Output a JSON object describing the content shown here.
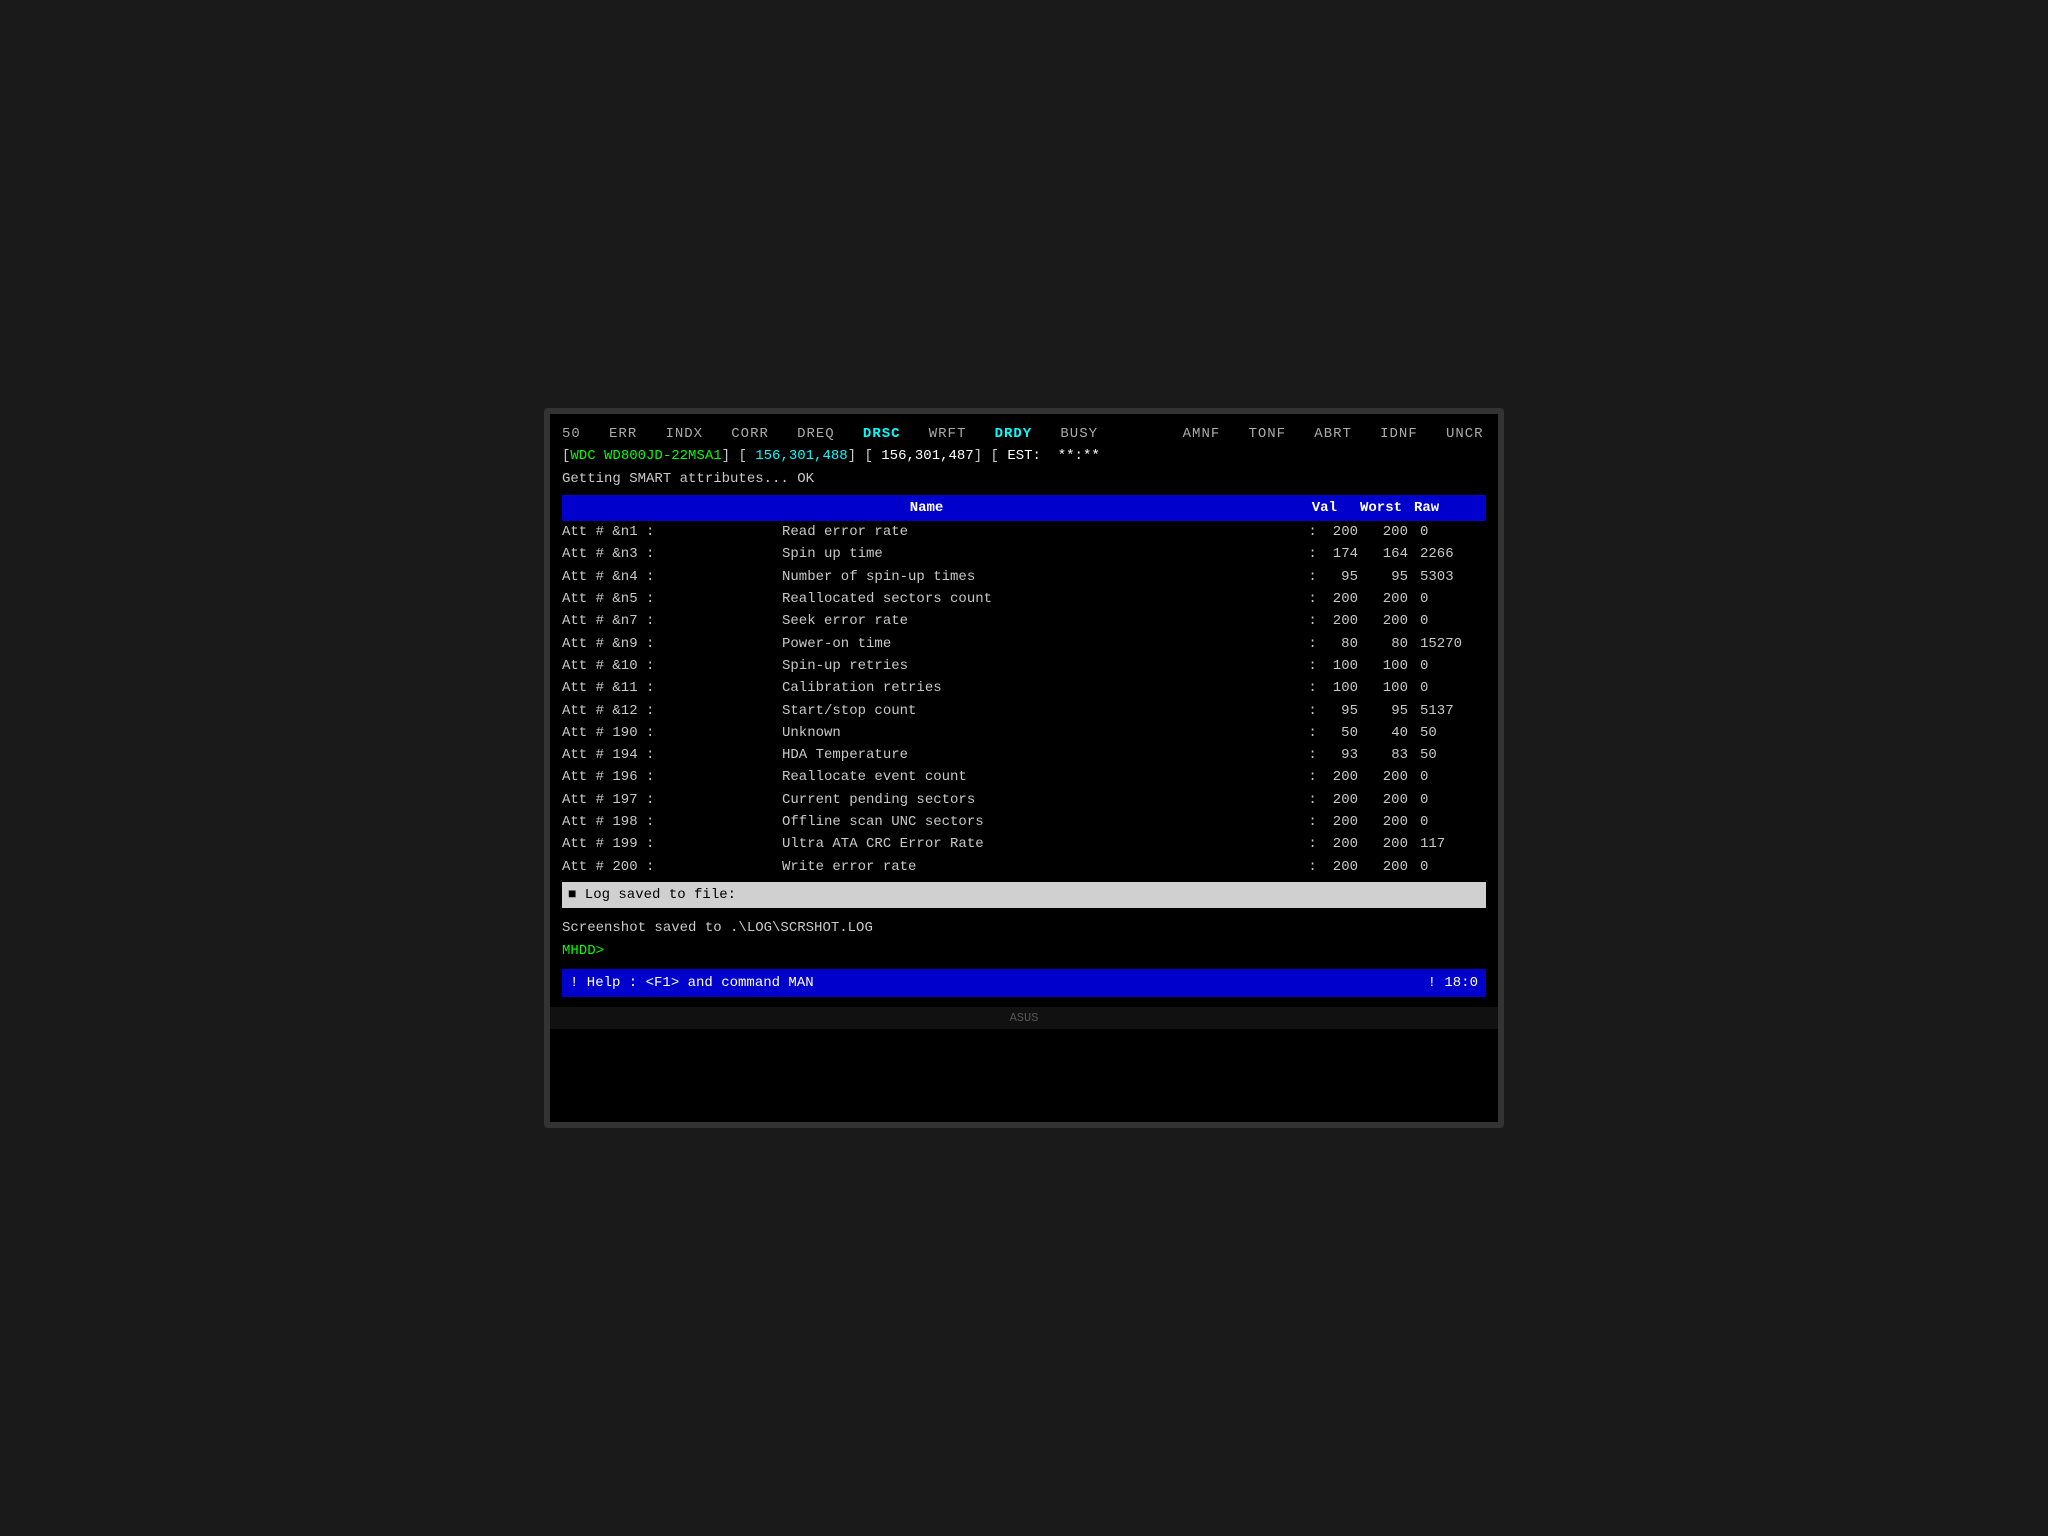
{
  "monitor": {
    "brand": "ASUS"
  },
  "statusBar": {
    "items": [
      {
        "label": "50",
        "type": "normal"
      },
      {
        "label": "ERR",
        "type": "normal"
      },
      {
        "label": "INDX",
        "type": "normal"
      },
      {
        "label": "CORR",
        "type": "normal"
      },
      {
        "label": "DREQ",
        "type": "normal"
      },
      {
        "label": "DRSC",
        "type": "highlight"
      },
      {
        "label": "WRFT",
        "type": "normal"
      },
      {
        "label": "DRDY",
        "type": "highlight"
      },
      {
        "label": "BUSY",
        "type": "normal"
      },
      {
        "label": "AMNF",
        "type": "normal"
      },
      {
        "label": "TONF",
        "type": "normal"
      },
      {
        "label": "ABRT",
        "type": "normal"
      },
      {
        "label": "IDNF",
        "type": "normal"
      },
      {
        "label": "UNCR",
        "type": "normal"
      }
    ]
  },
  "deviceLine": {
    "device": "WDC WD800JD-22MSA1",
    "size1": "156,301,488",
    "size2": "156,301,487",
    "est": "**:**"
  },
  "okLine": "Getting SMART attributes... OK",
  "tableHeader": {
    "name": "Name",
    "val": "Val",
    "worst": "Worst",
    "raw": "Raw"
  },
  "attributes": [
    {
      "num": "1",
      "name": "Read error rate",
      "val": "200",
      "worst": "200",
      "raw": "0"
    },
    {
      "num": "3",
      "name": "Spin up time",
      "val": "174",
      "worst": "164",
      "raw": "2266"
    },
    {
      "num": "4",
      "name": "Number of spin-up times",
      "val": "95",
      "worst": "95",
      "raw": "5303"
    },
    {
      "num": "5",
      "name": "Reallocated sectors count",
      "val": "200",
      "worst": "200",
      "raw": "0"
    },
    {
      "num": "7",
      "name": "Seek error rate",
      "val": "200",
      "worst": "200",
      "raw": "0"
    },
    {
      "num": "9",
      "name": "Power-on time",
      "val": "80",
      "worst": "80",
      "raw": "15270"
    },
    {
      "num": "10",
      "name": "Spin-up retries",
      "val": "100",
      "worst": "100",
      "raw": "0"
    },
    {
      "num": "11",
      "name": "Calibration retries",
      "val": "100",
      "worst": "100",
      "raw": "0"
    },
    {
      "num": "12",
      "name": "Start/stop count",
      "val": "95",
      "worst": "95",
      "raw": "5137"
    },
    {
      "num": "190",
      "name": "Unknown",
      "val": "50",
      "worst": "40",
      "raw": "50"
    },
    {
      "num": "194",
      "name": "HDA Temperature",
      "val": "93",
      "worst": "83",
      "raw": "50"
    },
    {
      "num": "196",
      "name": "Reallocate event count",
      "val": "200",
      "worst": "200",
      "raw": "0"
    },
    {
      "num": "197",
      "name": "Current pending sectors",
      "val": "200",
      "worst": "200",
      "raw": "0"
    },
    {
      "num": "198",
      "name": "Offline scan UNC sectors",
      "val": "200",
      "worst": "200",
      "raw": "0"
    },
    {
      "num": "199",
      "name": "Ultra ATA CRC Error Rate",
      "val": "200",
      "worst": "200",
      "raw": "117"
    },
    {
      "num": "200",
      "name": "Write error rate",
      "val": "200",
      "worst": "200",
      "raw": "0"
    }
  ],
  "logBar": "■ Log saved to file:",
  "screenshotLine": "Screenshot saved to .\\LOG\\SCRSHOT.LOG",
  "prompt": "MHDD>",
  "helpBar": {
    "left": "! Help : <F1> and command MAN",
    "right": "! 18:0"
  }
}
